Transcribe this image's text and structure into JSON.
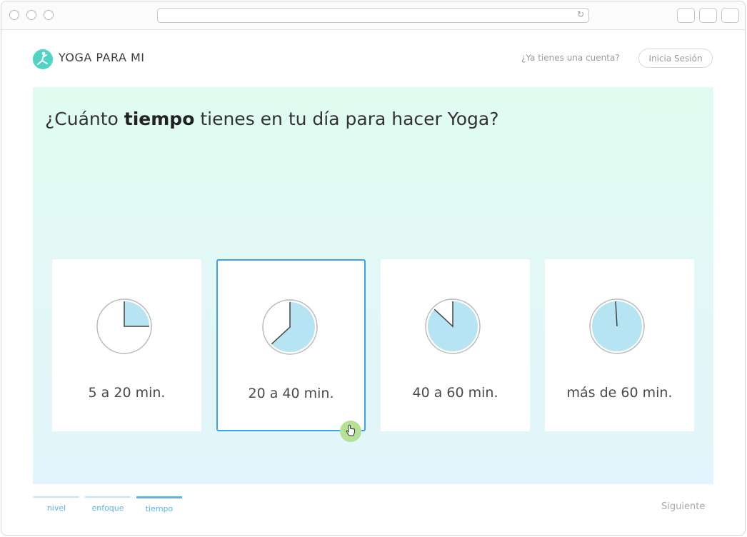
{
  "browser": {
    "reload_glyph": "↻"
  },
  "header": {
    "brand": "YOGA PARA MI",
    "have_account": "¿Ya tienes una cuenta?",
    "login": "Inicia Sesión"
  },
  "question": {
    "prefix": "¿Cuánto ",
    "bold": "tiempo",
    "suffix": " tienes en tu día para hacer Yoga?"
  },
  "options": [
    {
      "label": "5 a 20 min.",
      "fill_fraction": 0.25
    },
    {
      "label": "20 a 40 min.",
      "fill_fraction": 0.62
    },
    {
      "label": "40 a 60 min.",
      "fill_fraction": 0.9
    },
    {
      "label": "más de 60 min.",
      "fill_fraction": 1.0
    }
  ],
  "selected_option": 1,
  "steps": [
    {
      "label": "nivel",
      "active": false
    },
    {
      "label": "enfoque",
      "active": false
    },
    {
      "label": "tiempo",
      "active": true
    }
  ],
  "next_label": "Siguiente",
  "colors": {
    "accent": "#3fa0ec",
    "logo": "#4fd3c4",
    "clock_fill": "#b7e4f2"
  }
}
